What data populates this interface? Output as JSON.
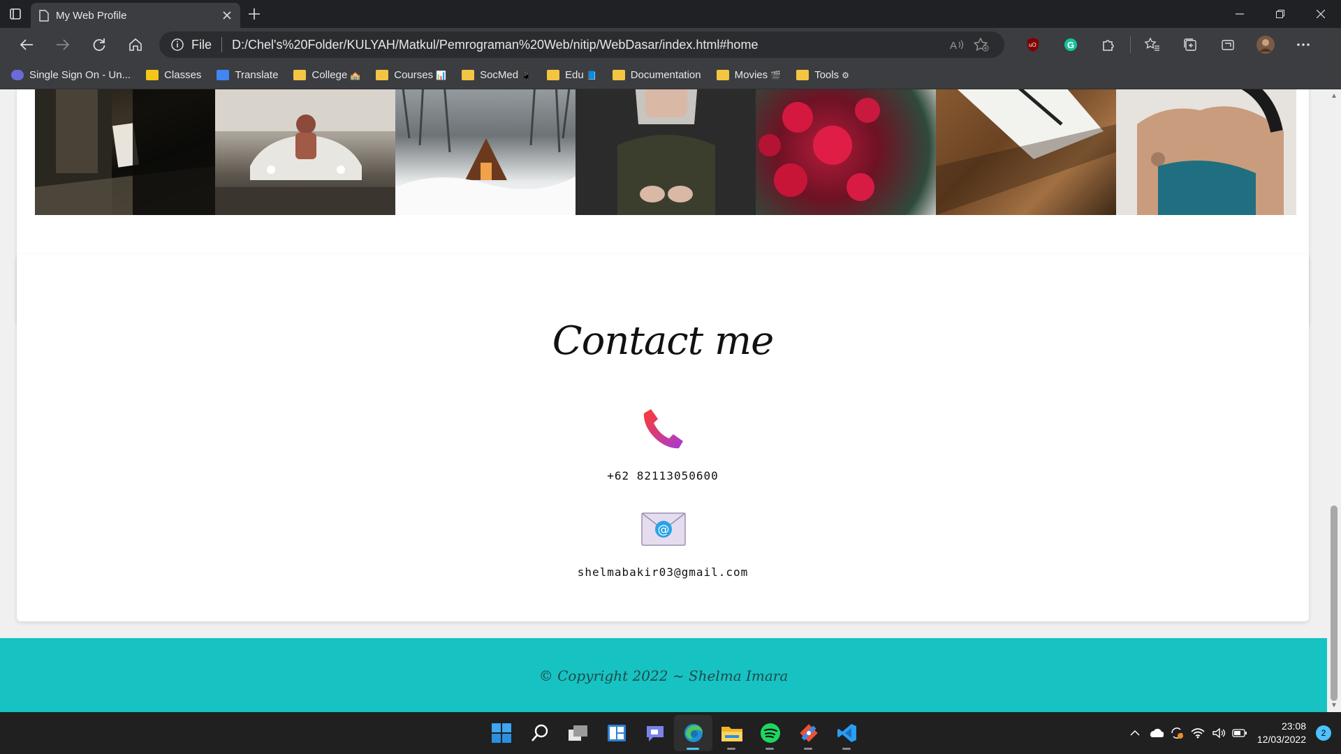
{
  "browser": {
    "tab_title": "My Web Profile",
    "address_prefix": "File",
    "url": "D:/Chel's%20Folder/KULYAH/Matkul/Pemrograman%20Web/nitip/WebDasar/index.html#home"
  },
  "bookmarks": [
    {
      "label": "Single Sign On - Un...",
      "icon": "sso-icon"
    },
    {
      "label": "Classes",
      "icon": "classroom-icon"
    },
    {
      "label": "Translate",
      "icon": "translate-icon"
    },
    {
      "label": "College",
      "icon": "folder-icon",
      "emoji": "🏫"
    },
    {
      "label": "Courses",
      "icon": "folder-icon",
      "emoji": "📊"
    },
    {
      "label": "SocMed",
      "icon": "folder-icon",
      "emoji": "📱"
    },
    {
      "label": "Edu",
      "icon": "folder-icon",
      "emoji": "📘"
    },
    {
      "label": "Documentation",
      "icon": "folder-icon",
      "emoji": ""
    },
    {
      "label": "Movies",
      "icon": "folder-icon",
      "emoji": "🎬"
    },
    {
      "label": "Tools",
      "icon": "folder-icon",
      "emoji": "⚙"
    }
  ],
  "page": {
    "contact_title": "Contact me",
    "phone": "+62 82113050600",
    "email": "shelmabakir03@gmail.com",
    "footer": "© Copyright 2022 ~ Shelma Imara"
  },
  "gallery": [
    "street-photo",
    "car-photo",
    "snow-cabin-photo",
    "woman-sitting-photo",
    "red-flowers-photo",
    "notebook-pen-photo",
    "woman-portrait-photo"
  ],
  "taskbar": {
    "apps": [
      "start-icon",
      "search-icon",
      "task-view-icon",
      "widgets-icon",
      "chat-icon",
      "edge-icon",
      "file-explorer-icon",
      "spotify-icon",
      "git-icon",
      "vscode-icon"
    ],
    "time": "23:08",
    "date": "12/03/2022",
    "notifications": "2"
  },
  "colors": {
    "footer_bg": "#17c2c2",
    "chrome_bg": "#3b3d41",
    "taskbar_bg": "#202020"
  }
}
